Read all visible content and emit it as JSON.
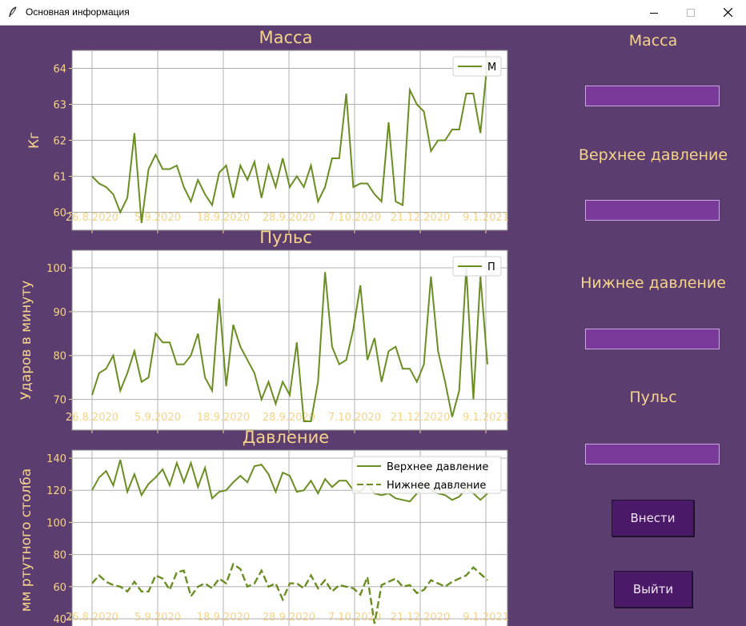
{
  "window": {
    "title": "Основная информация"
  },
  "colors": {
    "background": "#5c3d70",
    "line": "#6b8e23",
    "label": "#f5d48a",
    "entry": "#7a3a9a",
    "button": "#4a1a68"
  },
  "icons": {
    "app": "feather-icon",
    "minimize": "minimize-icon",
    "maximize": "maximize-icon",
    "close": "close-icon"
  },
  "side": {
    "mass_label": "Масса",
    "upper_label": "Верхнее давление",
    "lower_label": "Нижнее давление",
    "pulse_label": "Пульс",
    "mass_value": "",
    "upper_value": "",
    "lower_value": "",
    "pulse_value": "",
    "submit_label": "Внести",
    "exit_label": "Выйти"
  },
  "chart_data": [
    {
      "type": "line",
      "title": "Масса",
      "xlabel": "",
      "ylabel": "Кг",
      "xticklabels": [
        "26.8.2020",
        "5.9.2020",
        "18.9.2020",
        "28.9.2020",
        "7.10.2020",
        "21.12.2020",
        "9.1.2021"
      ],
      "ylim": [
        59.5,
        64.5
      ],
      "yticks": [
        60,
        61,
        62,
        63,
        64
      ],
      "grid": true,
      "legend": "top-right",
      "series": [
        {
          "name": "М",
          "style": "solid",
          "values": [
            61.0,
            60.8,
            60.7,
            60.5,
            60.0,
            60.4,
            62.2,
            59.7,
            61.2,
            61.6,
            61.2,
            61.2,
            61.3,
            60.7,
            60.3,
            60.9,
            60.5,
            60.2,
            61.1,
            61.3,
            60.4,
            61.3,
            60.9,
            61.4,
            60.4,
            61.3,
            60.7,
            61.5,
            60.7,
            61.0,
            60.7,
            61.3,
            60.3,
            60.7,
            61.5,
            61.5,
            63.3,
            60.7,
            60.8,
            60.8,
            60.5,
            60.3,
            62.5,
            60.3,
            60.2,
            63.4,
            63.0,
            62.8,
            61.7,
            62.0,
            62.0,
            62.3,
            62.3,
            63.3,
            63.3,
            62.2,
            64.2
          ]
        }
      ]
    },
    {
      "type": "line",
      "title": "Пульс",
      "xlabel": "",
      "ylabel": "Ударов в минуту",
      "xticklabels": [
        "26.8.2020",
        "5.9.2020",
        "18.9.2020",
        "28.9.2020",
        "7.10.2020",
        "21.12.2020",
        "9.1.2021"
      ],
      "ylim": [
        63,
        104
      ],
      "yticks": [
        70,
        80,
        90,
        100
      ],
      "grid": true,
      "legend": "top-right",
      "series": [
        {
          "name": "П",
          "style": "solid",
          "values": [
            71,
            76,
            77,
            80,
            72,
            76,
            81,
            74,
            75,
            85,
            83,
            83,
            78,
            78,
            80,
            85,
            75,
            72,
            93,
            73,
            87,
            82,
            79,
            76,
            70,
            74,
            69,
            74,
            71,
            83,
            65,
            65,
            74,
            99,
            82,
            78,
            79,
            86,
            96,
            79,
            84,
            74,
            81,
            82,
            77,
            77,
            74,
            78,
            98,
            81,
            74,
            66,
            72,
            100,
            70,
            98,
            78
          ]
        }
      ]
    },
    {
      "type": "line",
      "title": "Давление",
      "xlabel": "",
      "ylabel": "мм ртутного столба",
      "xticklabels": [
        "26.8.2020",
        "5.9.2020",
        "18.9.2020",
        "28.9.2020",
        "7.10.2020",
        "21.12.2020",
        "9.1.2021"
      ],
      "ylim": [
        33,
        145
      ],
      "yticks": [
        40,
        60,
        80,
        100,
        120,
        140
      ],
      "grid": true,
      "legend": "top-right",
      "series": [
        {
          "name": "Верхнее давление",
          "style": "solid",
          "values": [
            120,
            128,
            132,
            123,
            139,
            119,
            130,
            117,
            124,
            128,
            133,
            123,
            137,
            125,
            137,
            122,
            134,
            115,
            119,
            120,
            125,
            129,
            125,
            135,
            136,
            130,
            119,
            131,
            129,
            119,
            120,
            126,
            118,
            127,
            122,
            126,
            126,
            120,
            119,
            124,
            118,
            117,
            118,
            115,
            114,
            113,
            118,
            124,
            120,
            118,
            117,
            114,
            116,
            121,
            118,
            114,
            118
          ]
        },
        {
          "name": "Нижнее давление",
          "style": "dashed",
          "values": [
            62,
            67,
            63,
            61,
            60,
            57,
            63,
            57,
            57,
            67,
            65,
            58,
            69,
            70,
            54,
            60,
            62,
            59,
            65,
            62,
            74,
            71,
            60,
            62,
            70,
            60,
            62,
            52,
            62,
            62,
            59,
            67,
            59,
            64,
            57,
            61,
            60,
            59,
            55,
            66,
            37,
            61,
            63,
            65,
            60,
            61,
            56,
            58,
            64,
            62,
            60,
            63,
            65,
            67,
            72,
            68,
            64
          ]
        }
      ]
    }
  ]
}
